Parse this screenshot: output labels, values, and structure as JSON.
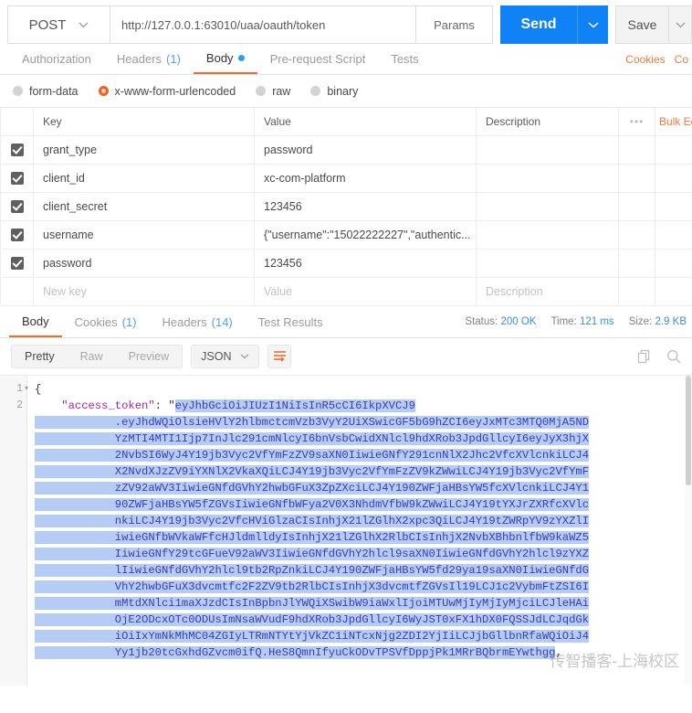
{
  "request": {
    "method": "POST",
    "method_caret": "⌄",
    "url": "http://127.0.0.1:63010/uaa/oauth/token",
    "params_label": "Params",
    "send_label": "Send",
    "save_label": "Save"
  },
  "request_tabs": [
    {
      "label": "Authorization",
      "count": "",
      "active": false,
      "dot": false
    },
    {
      "label": "Headers",
      "count": "(1)",
      "active": false,
      "dot": false
    },
    {
      "label": "Body",
      "count": "",
      "active": true,
      "dot": true
    },
    {
      "label": "Pre-request Script",
      "count": "",
      "active": false,
      "dot": false
    },
    {
      "label": "Tests",
      "count": "",
      "active": false,
      "dot": false
    }
  ],
  "request_tabs_right": [
    "Cookies",
    "Co"
  ],
  "body_modes": [
    {
      "label": "form-data",
      "selected": false
    },
    {
      "label": "x-www-form-urlencoded",
      "selected": true
    },
    {
      "label": "raw",
      "selected": false
    },
    {
      "label": "binary",
      "selected": false
    }
  ],
  "kv_table": {
    "headers": [
      "Key",
      "Value",
      "Description"
    ],
    "bulk_edit_label": "Bulk Ed",
    "rows": [
      {
        "checked": true,
        "key": "grant_type",
        "value": "password",
        "description": ""
      },
      {
        "checked": true,
        "key": "client_id",
        "value": "xc-com-platform",
        "description": ""
      },
      {
        "checked": true,
        "key": "client_secret",
        "value": "123456",
        "description": ""
      },
      {
        "checked": true,
        "key": "username",
        "value": "{\"username\":\"15022222227\",\"authentic...",
        "description": ""
      },
      {
        "checked": true,
        "key": "password",
        "value": "123456",
        "description": ""
      }
    ],
    "new_row": {
      "key_placeholder": "New key",
      "value_placeholder": "Value",
      "description_placeholder": "Description"
    }
  },
  "response_tabs": [
    {
      "label": "Body",
      "count": "",
      "active": true
    },
    {
      "label": "Cookies",
      "count": "(1)",
      "active": false
    },
    {
      "label": "Headers",
      "count": "(14)",
      "active": false
    },
    {
      "label": "Test Results",
      "count": "",
      "active": false
    }
  ],
  "response_meta": {
    "status_label": "Status:",
    "status_value": "200 OK",
    "time_label": "Time:",
    "time_value": "121 ms",
    "size_label": "Size:",
    "size_value": "2.9 KB"
  },
  "format_bar": {
    "views": [
      {
        "label": "Pretty",
        "active": true
      },
      {
        "label": "Raw",
        "active": false
      },
      {
        "label": "Preview",
        "active": false
      }
    ],
    "language": "JSON",
    "language_caret": "⌄",
    "wrap_icon": "wrap-lines-icon",
    "copy_icon": "copy-icon",
    "search_icon": "search-icon"
  },
  "code": {
    "line_numbers": [
      "1",
      "2"
    ],
    "open_brace": "{",
    "key_label": "\"access_token\"",
    "colon": ": ",
    "quote": "\"",
    "token_lines": [
      "eyJhbGciOiJIUzI1NiIsInR5cCI6IkpXVCJ9",
      ".eyJhdWQiOlsieHVlY2hlbmctcmVzb3VyY2UiXSwicGF5bG9hZCI6eyJxMTc3MTQ0MjA5ND",
      "YzMTI4MTI1Ijp7InJlc291cmNlcyI6bnVsbCwidXNlcl9hdXRob3JpdGllcyI6eyJyX3hjX",
      "2NvbSI6WyJ4Y19jb3Vyc2VfYmFzZV9saXN0IiwieGNfY291cnNlX2Jhc2VfcXVlcnkiLCJ4",
      "X2NvdXJzZV9iYXNlX2VkaXQiLCJ4Y19jb3Vyc2VfYmFzZV9kZWwiLCJ4Y19jb3Vyc2VfYmF",
      "zZV92aWV3IiwieGNfdGVhY2hwbGFuX3ZpZXciLCJ4Y190ZWFjaHBsYW5fcXVlcnkiLCJ4Y1",
      "90ZWFjaHBsYW5fZGVsIiwieGNfbWFya2V0X3NhdmVfbW9kZWwiLCJ4Y19tYXJrZXRfcXVlc",
      "nkiLCJ4Y19jb3Vyc2VfcHViGlzaCIsInhjX21lZGlhX2xpc3QiLCJ4Y19tZWRpYV9zYXZlI",
      "iwieGNfbWVkaWFfcHJldmlldyIsInhjX21lZGlhX2RlbCIsInhjX2NvbXBhbnlfbW9kaWZ5",
      "IiwieGNfY29tcGFueV92aWV3IiwieGNfdGVhY2hlcl9saXN0IiwieGNfdGVhY2hlcl9zYXZ",
      "lIiwieGNfdGVhY2hlcl9tb2RpZnkiLCJ4Y190ZWFjaHBsYW5fd29ya19saXN0IiwieGNfdG",
      "VhY2hwbGFuX3dvcmtfc2F2ZV9tb2RlbCIsInhjX3dvcmtfZGVsIl19LCJ1c2VybmFtZSI6I",
      "mMtdXNlci1maXJzdCIsInBpbnJlYWQiXSwibW9iaWxlIjoiMTUwMjIyMjIyMjciLCJleHAi",
      "OjE2ODcxOTc0ODUsImNsaWVudF9hdXRob3JpdGllcyI6WyJST0xFX1hDX0FQSSJdLCJqdGk",
      "iOiIxYmNkMhMC04ZGIyLTRmNTYtYjVkZC1iNTcxNjg2ZDI2YjIiLCJjbGllbnRfaWQiOiJ4",
      "Yy1jb20tcGxhdGZvcm0ifQ.HeS8QmnIfyuCkODvTPSVfDppjPk1MRrBQbrmEYwthgg"
    ],
    "trailing_comma": ","
  },
  "watermark": "传智播客-上海校区"
}
